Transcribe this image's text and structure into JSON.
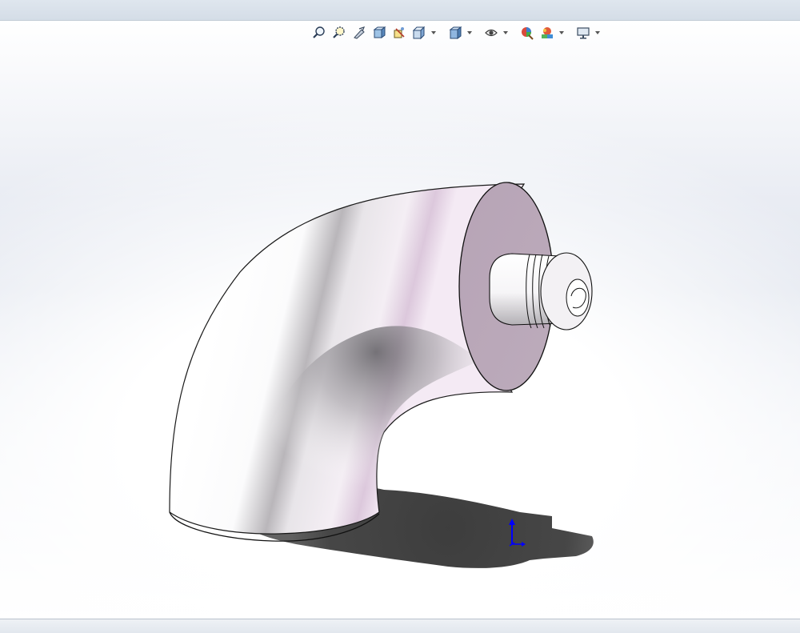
{
  "window": {
    "top_bar_color": "#dae2eb",
    "viewport_background": "gradient-white-to-pale-blue-grey"
  },
  "toolbar": {
    "buttons": [
      {
        "icon": "zoom-to-fit-icon",
        "dropdown": false
      },
      {
        "icon": "zoom-to-area-icon",
        "dropdown": false
      },
      {
        "icon": "previous-view-icon",
        "dropdown": false
      },
      {
        "icon": "section-view-icon",
        "dropdown": false
      },
      {
        "icon": "dynamic-annotation-views-icon",
        "dropdown": false
      },
      {
        "icon": "view-orientation-icon",
        "dropdown": true
      },
      {
        "icon": "display-style-icon",
        "dropdown": true
      },
      {
        "icon": "hide-show-items-icon",
        "dropdown": true
      },
      {
        "icon": "edit-appearance-icon",
        "dropdown": false
      },
      {
        "icon": "apply-scene-icon",
        "dropdown": true
      },
      {
        "icon": "view-settings-icon",
        "dropdown": true
      }
    ]
  },
  "model": {
    "name": "pipe-elbow-with-stub",
    "body_color": "#ffffff",
    "face_color": "#b9a6b7",
    "shadow_color": "#3a3a3a"
  },
  "triad": {
    "axis_color": "#0000ff"
  }
}
